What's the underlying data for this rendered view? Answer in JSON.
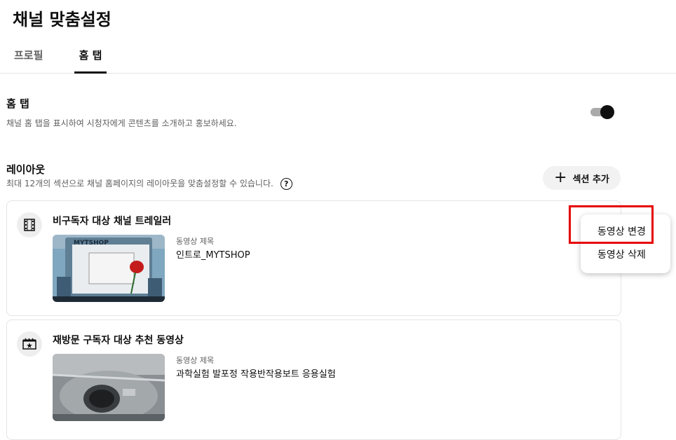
{
  "page_title": "채널 맞춤설정",
  "tabs": [
    {
      "label": "프로필",
      "active": false
    },
    {
      "label": "홈 탭",
      "active": true
    }
  ],
  "home_tab": {
    "title": "홈 탭",
    "description": "채널 홈 탭을 표시하여 시청자에게 콘텐츠를 소개하고 홍보하세요.",
    "toggle_on": true
  },
  "layout": {
    "title": "레이아웃",
    "description": "최대 12개의 섹션으로 채널 홈페이지의 레이아웃을 맞춤설정할 수 있습니다.",
    "help_glyph": "?",
    "add_section_label": "섹션 추가",
    "add_icon": "+"
  },
  "sections": [
    {
      "title": "비구독자 대상 채널 트레일러",
      "icon": "trailer-icon",
      "video_label": "동영상 제목",
      "video_title": "인트로_MYTSHOP",
      "thumb_text": "MYTSHOP"
    },
    {
      "title": "재방문 구독자 대상 추천 동영상",
      "icon": "featured-video-icon",
      "video_label": "동영상 제목",
      "video_title": "과학실험 발포정 작용반작용보트 응용실험"
    }
  ],
  "context_menu": {
    "items": [
      "동영상 변경",
      "동영상 삭제"
    ]
  },
  "colors": {
    "highlight": "#e60000",
    "text": "#0f0f0f",
    "secondary_text": "#606060"
  }
}
